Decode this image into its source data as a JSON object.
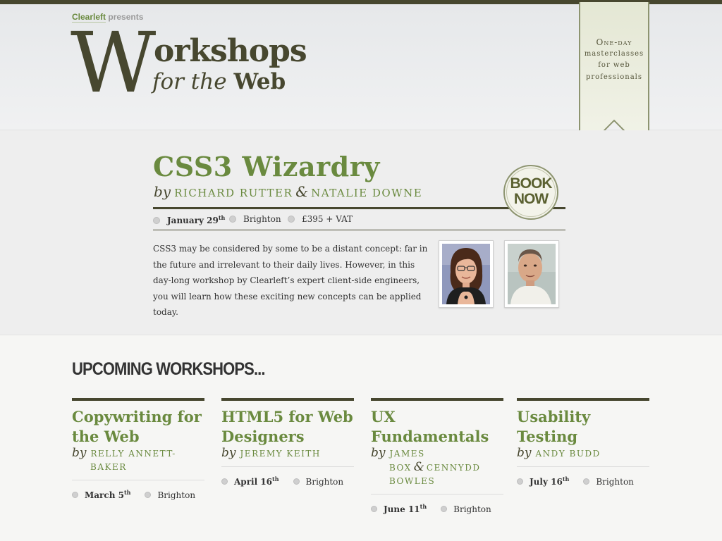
{
  "header": {
    "presents_brand": "Clearleft",
    "presents_text": "presents",
    "logo_initial": "W",
    "logo_rest": "orkshops",
    "logo_sub_italic": "for the",
    "logo_sub_bold": "Web"
  },
  "ribbon": {
    "line1": "One-day",
    "line2": "masterclasses",
    "line3": "for web",
    "line4": "professionals"
  },
  "feature": {
    "title": "CSS3 Wizardry",
    "by_word": "by",
    "speaker1": "RICHARD RUTTER",
    "amp": "&",
    "speaker2": "NATALIE DOWNE",
    "date_day": "January 29",
    "date_suffix": "th",
    "location": "Brighton",
    "price": "£395 + VAT",
    "book_line1": "BOOK",
    "book_line2": "NOW",
    "description": "CSS3 may be considered by some to be a distant concept: far in the future and irrelevant to their daily lives. However, in this day-long workshop by Clearleft’s expert client-side engineers, you will learn how these exciting new concepts can be applied today."
  },
  "upcoming_heading": "UPCOMING WORKSHOPS...",
  "workshops": [
    {
      "title": "Copywriting for the Web",
      "by": "by",
      "speaker": "RELLY ANNETT-BAKER",
      "date_day": "March 5",
      "date_suffix": "th",
      "location": "Brighton"
    },
    {
      "title": "HTML5 for Web Designers",
      "by": "by",
      "speaker": "JEREMY KEITH",
      "date_day": "April 16",
      "date_suffix": "th",
      "location": "Brighton"
    },
    {
      "title": "UX Fundamentals",
      "by": "by",
      "speaker": "JAMES BOX",
      "amp": "&",
      "speaker2": "CENNYDD BOWLES",
      "date_day": "June 11",
      "date_suffix": "th",
      "location": "Brighton"
    },
    {
      "title": "Usability Testing",
      "by": "by",
      "speaker": "ANDY BUDD",
      "date_day": "July 16",
      "date_suffix": "th",
      "location": "Brighton"
    }
  ],
  "colors": {
    "accent_green": "#6a8a3f",
    "dark_olive": "#47472f"
  }
}
